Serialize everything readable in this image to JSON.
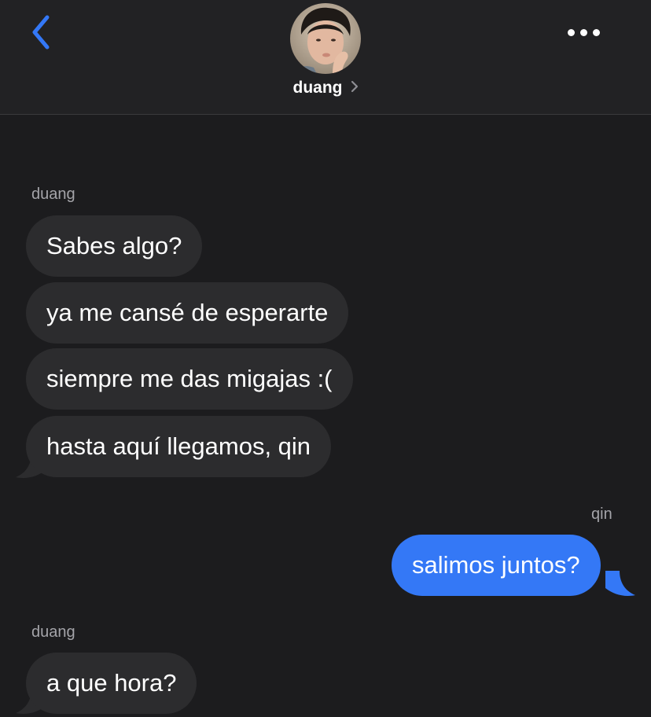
{
  "header": {
    "back_icon": "chevron-left-icon",
    "contact_name": "duang",
    "more_icon": "ellipsis-icon",
    "accent_color": "#3478f6"
  },
  "thread": {
    "group1": {
      "sender": "duang",
      "messages": [
        "Sabes algo?",
        "ya me cansé de esperarte",
        "siempre me das migajas :(",
        "hasta aquí llegamos, qin"
      ]
    },
    "group2": {
      "sender": "qin",
      "messages": [
        "salimos juntos?"
      ]
    },
    "group3": {
      "sender": "duang",
      "messages": [
        "a que hora?"
      ]
    }
  },
  "colors": {
    "background": "#1c1c1e",
    "incoming_bubble": "#2c2c2e",
    "outgoing_bubble": "#3478f6",
    "sender_label": "#a4a4a9"
  }
}
